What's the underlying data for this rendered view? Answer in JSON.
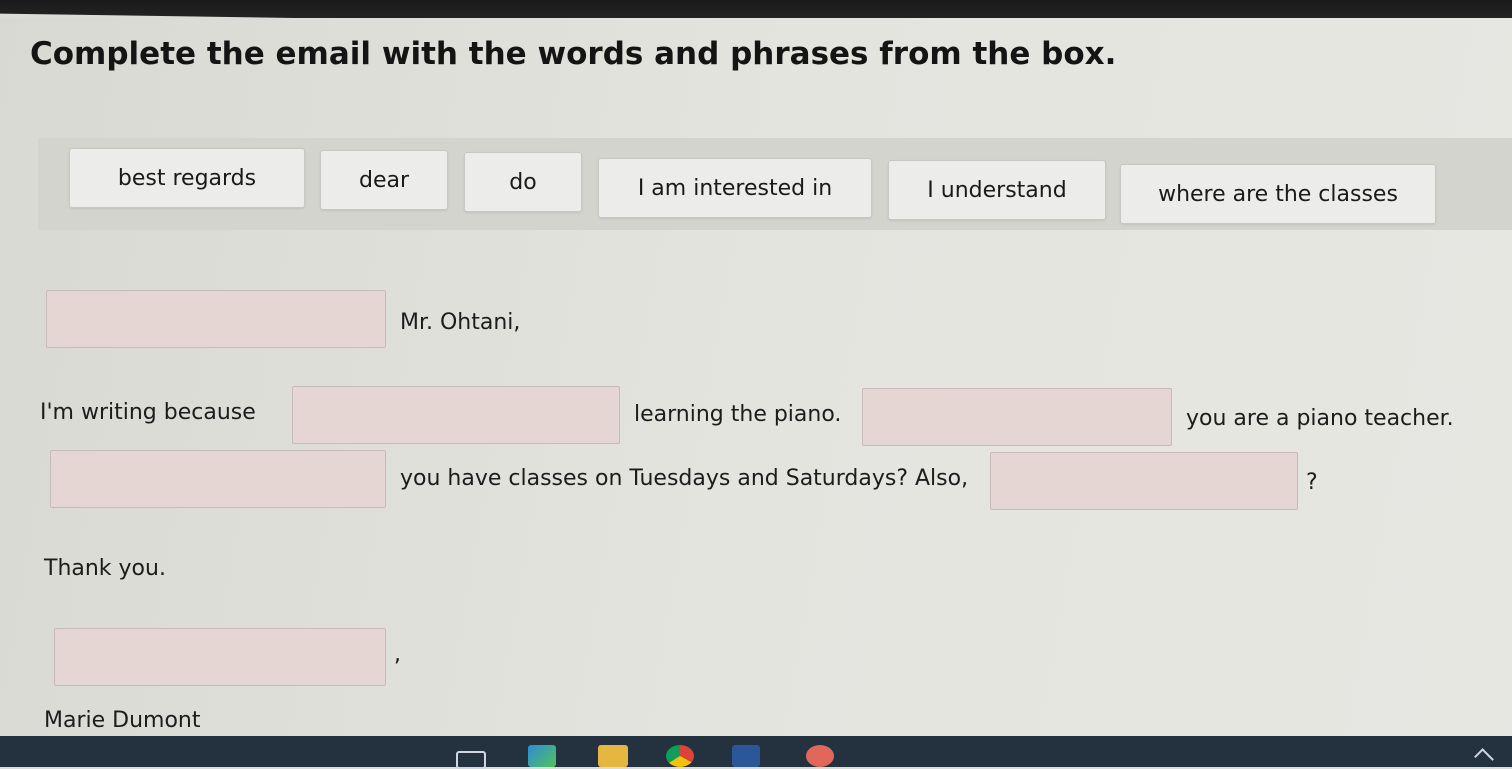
{
  "exercise": {
    "instruction": "Complete the email with the words and phrases from the box."
  },
  "word_box": {
    "items": [
      "best regards",
      "dear",
      "do",
      "I am interested in",
      "I understand",
      "where are the classes"
    ]
  },
  "email": {
    "salutation_suffix": "Mr. Ohtani,",
    "line1_start": "I'm writing because",
    "line1_mid": "learning the piano.",
    "line1_end": "you are a piano teacher.",
    "line2_mid": "you have classes on Tuesdays and Saturdays? Also,",
    "line2_end": "?",
    "thanks": "Thank you.",
    "closing_suffix": ",",
    "signature": "Marie Dumont"
  },
  "colors": {
    "blank_fill": "#e6d6d3",
    "chip_fill": "#ececea",
    "taskbar": "#24313f"
  },
  "taskbar_icons": [
    "task-view-icon",
    "edge-icon",
    "file-explorer-icon",
    "chrome-icon",
    "word-icon",
    "app-icon",
    "tray-chevron-up-icon"
  ]
}
